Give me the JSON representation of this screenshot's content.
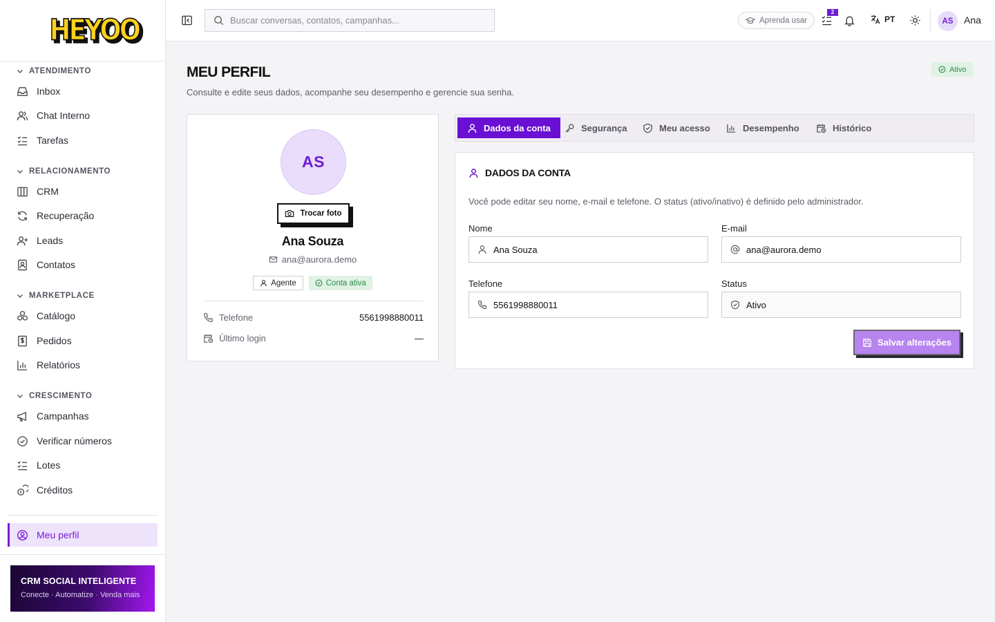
{
  "brand": {
    "logo_text": "HEYOO"
  },
  "sidebar": {
    "sections": [
      {
        "label": "ATENDIMENTO",
        "items": [
          "Inbox",
          "Chat Interno",
          "Tarefas"
        ]
      },
      {
        "label": "RELACIONAMENTO",
        "items": [
          "CRM",
          "Recuperação",
          "Leads",
          "Contatos"
        ]
      },
      {
        "label": "MARKETPLACE",
        "items": [
          "Catálogo",
          "Pedidos",
          "Relatórios"
        ]
      },
      {
        "label": "CRESCIMENTO",
        "items": [
          "Campanhas",
          "Verificar números",
          "Lotes",
          "Créditos"
        ]
      }
    ],
    "active_item": "Meu perfil",
    "promo": {
      "title": "CRM SOCIAL INTELIGENTE",
      "subtitle": "Conecte · Automatize · Venda mais"
    }
  },
  "header": {
    "search_placeholder": "Buscar conversas, contatos, campanhas...",
    "learn_label": "Aprenda usar",
    "tasks_badge": "2",
    "language": "PT",
    "user_initials": "AS",
    "user_name": "Ana"
  },
  "page": {
    "title": "MEU PERFIL",
    "subtitle": "Consulte e edite seus dados, acompanhe seu desempenho e gerencie sua senha.",
    "status_badge": "Ativo"
  },
  "profile": {
    "initials": "AS",
    "change_photo": "Trocar foto",
    "name": "Ana Souza",
    "email": "ana@aurora.demo",
    "role": "Agente",
    "account_status": "Conta ativa",
    "phone_label": "Telefone",
    "phone": "5561998880011",
    "last_login_label": "Último login",
    "last_login": "—"
  },
  "tabs": [
    "Dados da conta",
    "Segurança",
    "Meu acesso",
    "Desempenho",
    "Histórico"
  ],
  "form": {
    "heading": "DADOS DA CONTA",
    "description": "Você pode editar seu nome, e-mail e telefone. O status (ativo/inativo) é definido pelo administrador.",
    "name_label": "Nome",
    "name_value": "Ana Souza",
    "email_label": "E-mail",
    "email_value": "ana@aurora.demo",
    "phone_label": "Telefone",
    "phone_value": "5561998880011",
    "status_label": "Status",
    "status_value": "Ativo",
    "save_label": "Salvar alterações"
  },
  "colors": {
    "accent": "#6a0fd4",
    "success": "#2e8a4a",
    "success_bg": "#dff2e4",
    "logo_yellow": "#ffd21a"
  }
}
